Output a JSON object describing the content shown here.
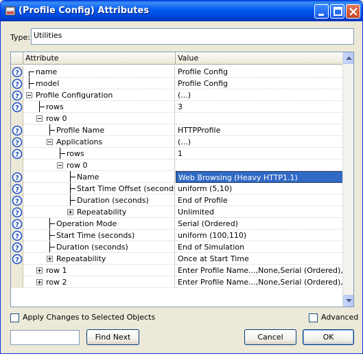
{
  "window": {
    "title": "(Profile Config) Attributes",
    "buttons": {
      "minimize": "minimize",
      "maximize": "maximize",
      "close": "close"
    }
  },
  "type_field": {
    "label": "Type:",
    "value": "Utilities"
  },
  "grid": {
    "headers": {
      "attribute": "Attribute",
      "value": "Value"
    },
    "rows": [
      {
        "label": "name",
        "value": "Profile Config",
        "help": true
      },
      {
        "label": "model",
        "value": "Profile Config",
        "help": true
      },
      {
        "label": "Profile Configuration",
        "value": "(...)",
        "help": true,
        "expander": "minus"
      },
      {
        "label": "rows",
        "value": "3",
        "help": true
      },
      {
        "label": "row 0",
        "value": "",
        "help": false,
        "expander": "minus"
      },
      {
        "label": "Profile Name",
        "value": "HTTPProfile",
        "help": true
      },
      {
        "label": "Applications",
        "value": "(...)",
        "help": true,
        "expander": "minus"
      },
      {
        "label": "rows",
        "value": "1",
        "help": true
      },
      {
        "label": "row 0",
        "value": "",
        "help": false,
        "expander": "minus"
      },
      {
        "label": "Name",
        "value": "Web Browsing (Heavy HTTP1.1)",
        "help": true,
        "selected": true
      },
      {
        "label": "Start Time Offset (seconds)",
        "value": "uniform (5,10)",
        "help": true
      },
      {
        "label": "Duration (seconds)",
        "value": "End of Profile",
        "help": true
      },
      {
        "label": "Repeatability",
        "value": "Unlimited",
        "help": true,
        "expander": "plus"
      },
      {
        "label": "Operation Mode",
        "value": "Serial (Ordered)",
        "help": true
      },
      {
        "label": "Start Time (seconds)",
        "value": "uniform (100,110)",
        "help": true
      },
      {
        "label": "Duration (seconds)",
        "value": "End of Simulation",
        "help": true
      },
      {
        "label": "Repeatability",
        "value": "Once at Start Time",
        "help": true,
        "expander": "plus"
      },
      {
        "label": "row 1",
        "value": "Enter Profile Name...,None,Serial (Ordered),unifo...",
        "help": false,
        "expander": "plus"
      },
      {
        "label": "row 2",
        "value": "Enter Profile Name...,None,Serial (Ordered),unifo...",
        "help": false,
        "expander": "plus"
      }
    ]
  },
  "options": {
    "apply_changes": {
      "label": "Apply Changes to Selected Objects",
      "checked": false
    },
    "advanced": {
      "label": "Advanced",
      "checked": false
    }
  },
  "footer": {
    "search_value": "",
    "find_next": "Find Next",
    "cancel": "Cancel",
    "ok": "OK"
  },
  "colors": {
    "titlebar": "#0058ee",
    "selection": "#316ac5",
    "help_icon": "#1c4fc4",
    "dialog_bg": "#ece9d8"
  }
}
